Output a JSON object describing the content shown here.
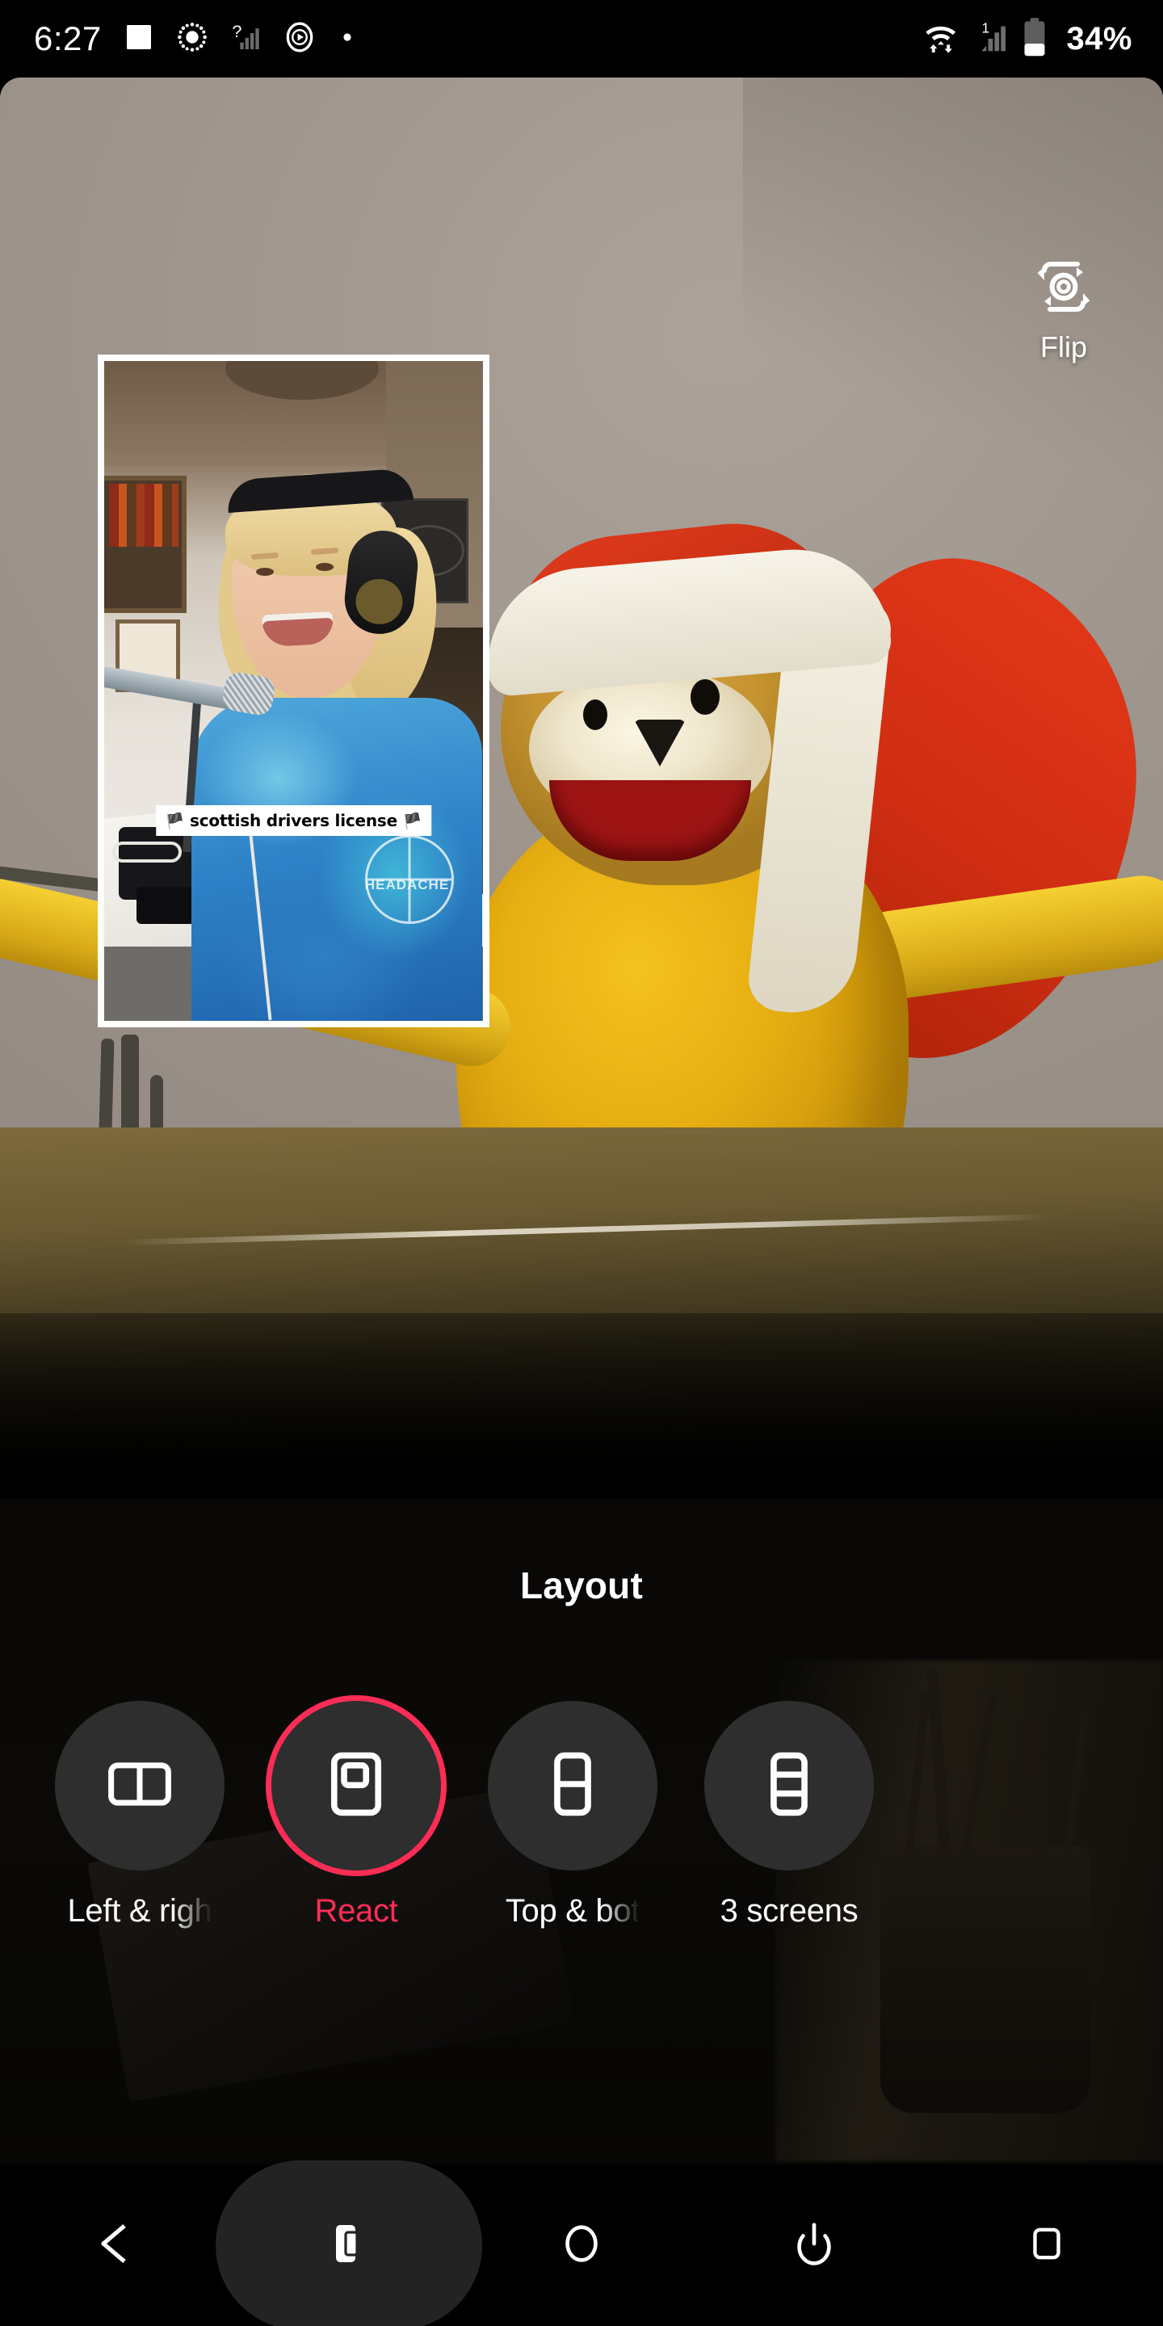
{
  "status_bar": {
    "time": "6:27",
    "battery_percent": "34%",
    "left_icons": [
      "photo-icon",
      "brightness-icon",
      "signal-unknown-icon",
      "media-play-icon",
      "dot-icon"
    ],
    "right_icons": [
      "wifi-transfer-icon",
      "cellular-signal-icon",
      "battery-icon"
    ]
  },
  "camera": {
    "flip_label": "Flip",
    "flip_icon": "flip-camera-icon"
  },
  "pip": {
    "caption": "scottish drivers license",
    "flag_left": "🏴",
    "flag_right": "🏴",
    "shirt_text": "HEADACHE"
  },
  "layout_panel": {
    "title": "Layout",
    "accent_color": "#ff2d55",
    "options": [
      {
        "label": "Left & righ",
        "icon": "layout-left-right-icon",
        "selected": false,
        "truncated": true
      },
      {
        "label": "React",
        "icon": "layout-react-icon",
        "selected": true,
        "truncated": false
      },
      {
        "label": "Top & bot",
        "icon": "layout-top-bottom-icon",
        "selected": false,
        "truncated": true
      },
      {
        "label": "3 screens",
        "icon": "layout-three-screens-icon",
        "selected": false,
        "truncated": false
      }
    ]
  },
  "nav_bar": {
    "buttons": [
      {
        "name": "back-button",
        "icon": "back-triangle-icon",
        "active": false
      },
      {
        "name": "screenshot-button",
        "icon": "phone-screenshot-icon",
        "active": true
      },
      {
        "name": "home-button",
        "icon": "home-circle-icon",
        "active": false
      },
      {
        "name": "power-button",
        "icon": "power-icon",
        "active": false
      },
      {
        "name": "recents-button",
        "icon": "square-recents-icon",
        "active": false
      }
    ]
  }
}
